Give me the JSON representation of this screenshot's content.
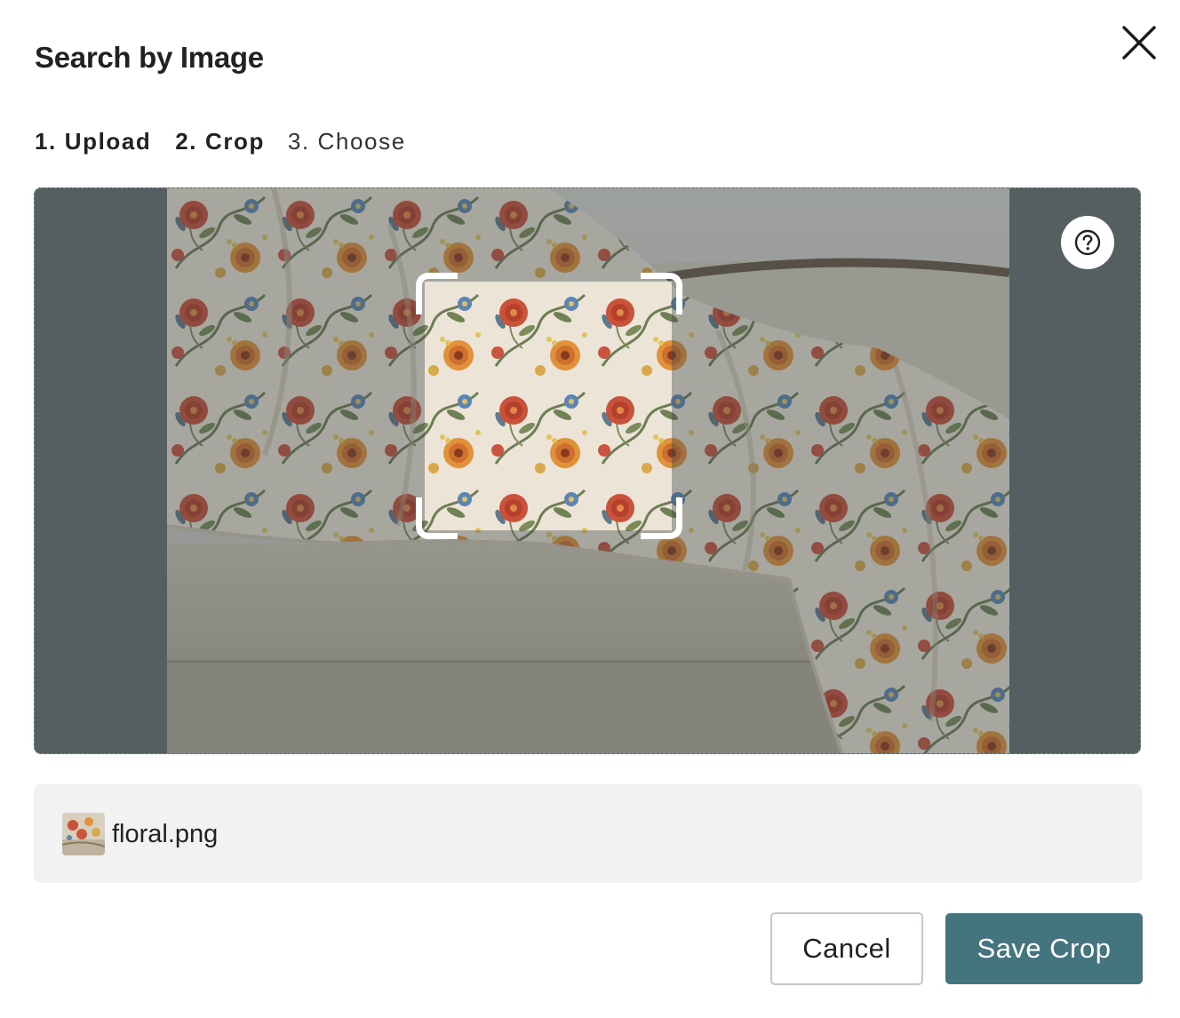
{
  "dialog": {
    "title": "Search by Image",
    "close_icon": "close-icon"
  },
  "steps": [
    {
      "label": "1. Upload",
      "state": "done"
    },
    {
      "label": "2. Crop",
      "state": "current"
    },
    {
      "label": "3. Choose",
      "state": "pending"
    }
  ],
  "crop": {
    "image_description_icon": "uploaded-image",
    "help_icon": "help-circle-icon"
  },
  "file": {
    "name": "floral.png",
    "thumb_icon": "image-thumbnail"
  },
  "actions": {
    "cancel_label": "Cancel",
    "save_label": "Save Crop"
  },
  "colors": {
    "primary": "#44747d",
    "crop_background": "#555f61",
    "file_bar": "#f1f2f1",
    "text": "#222222"
  }
}
